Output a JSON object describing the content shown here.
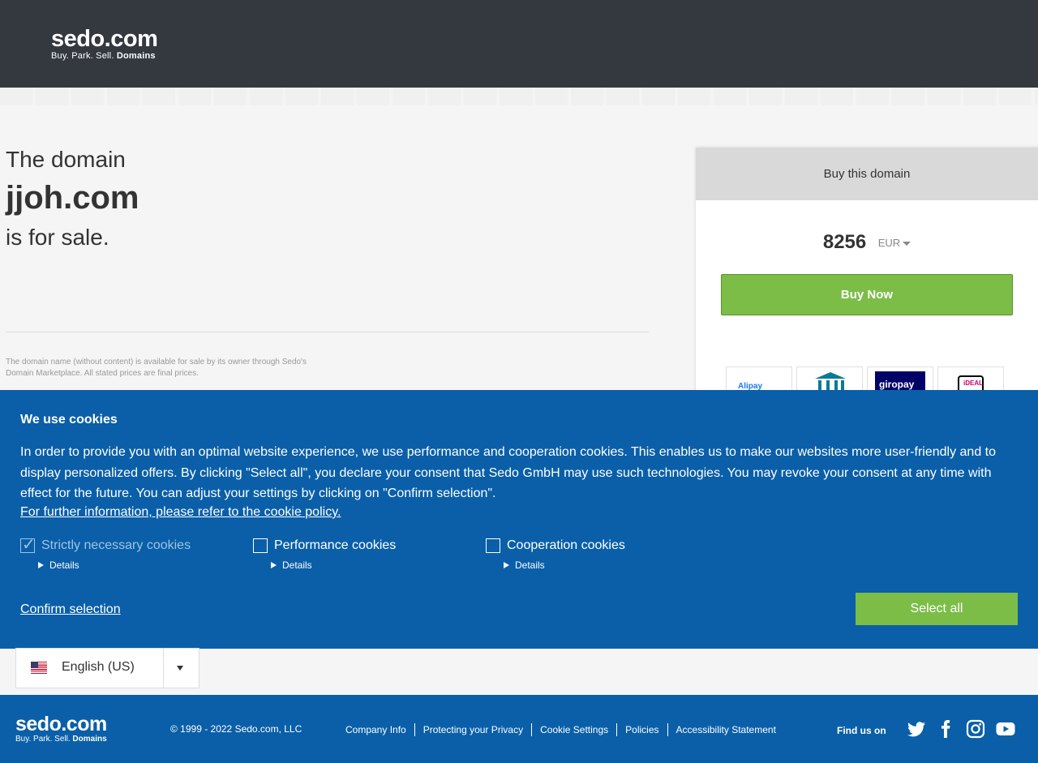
{
  "header": {
    "logo_wordmark": "sedo.com",
    "logo_tagline_plain": "Buy.  Park.  Sell.",
    "logo_tagline_bold": "Domains"
  },
  "hero": {
    "pre": "The domain",
    "domain": "jjoh.com",
    "post": "is for sale.",
    "disclaimer": "The domain name (without content) is available for sale by its owner through Sedo's Domain Marketplace. All stated prices are final prices."
  },
  "buybox": {
    "title": "Buy this domain",
    "price": "8256",
    "currency": "EUR",
    "buy_label": "Buy Now",
    "payments": [
      "Alipay",
      "bank-transfer-icon",
      "giropay",
      "iDEAL"
    ]
  },
  "cookies": {
    "title": "We use cookies",
    "text": "In order to provide you with an optimal website experience, we use performance and cooperation cookies. This enables us to make our websites more user-friendly and to display personalized offers. By clicking \"Select all\", you declare your consent that Sedo GmbH may use such technologies. You may revoke your consent at any time with effect for the future. You can adjust your settings by clicking on \"Confirm selection\".",
    "link": "For further information, please refer to the cookie policy.",
    "options": [
      {
        "label": "Strictly necessary cookies",
        "details": "Details",
        "checked": true
      },
      {
        "label": "Performance cookies",
        "details": "Details",
        "checked": false
      },
      {
        "label": "Cooperation cookies",
        "details": "Details",
        "checked": false
      }
    ],
    "confirm": "Confirm selection",
    "select_all": "Select all"
  },
  "language": {
    "selected": "English (US)"
  },
  "footer": {
    "logo_wordmark": "sedo.com",
    "logo_tagline_plain": "Buy.  Park.  Sell.",
    "logo_tagline_bold": "Domains",
    "copyright": "© 1999 - 2022 Sedo.com, LLC",
    "links": [
      "Company Info",
      "Protecting your Privacy",
      "Cookie Settings",
      "Policies",
      "Accessibility Statement"
    ],
    "find_us": "Find us on"
  },
  "colors": {
    "header_bg": "#34383f",
    "brand_blue": "#0a5fa8",
    "buy_green": "#7cbd47"
  }
}
